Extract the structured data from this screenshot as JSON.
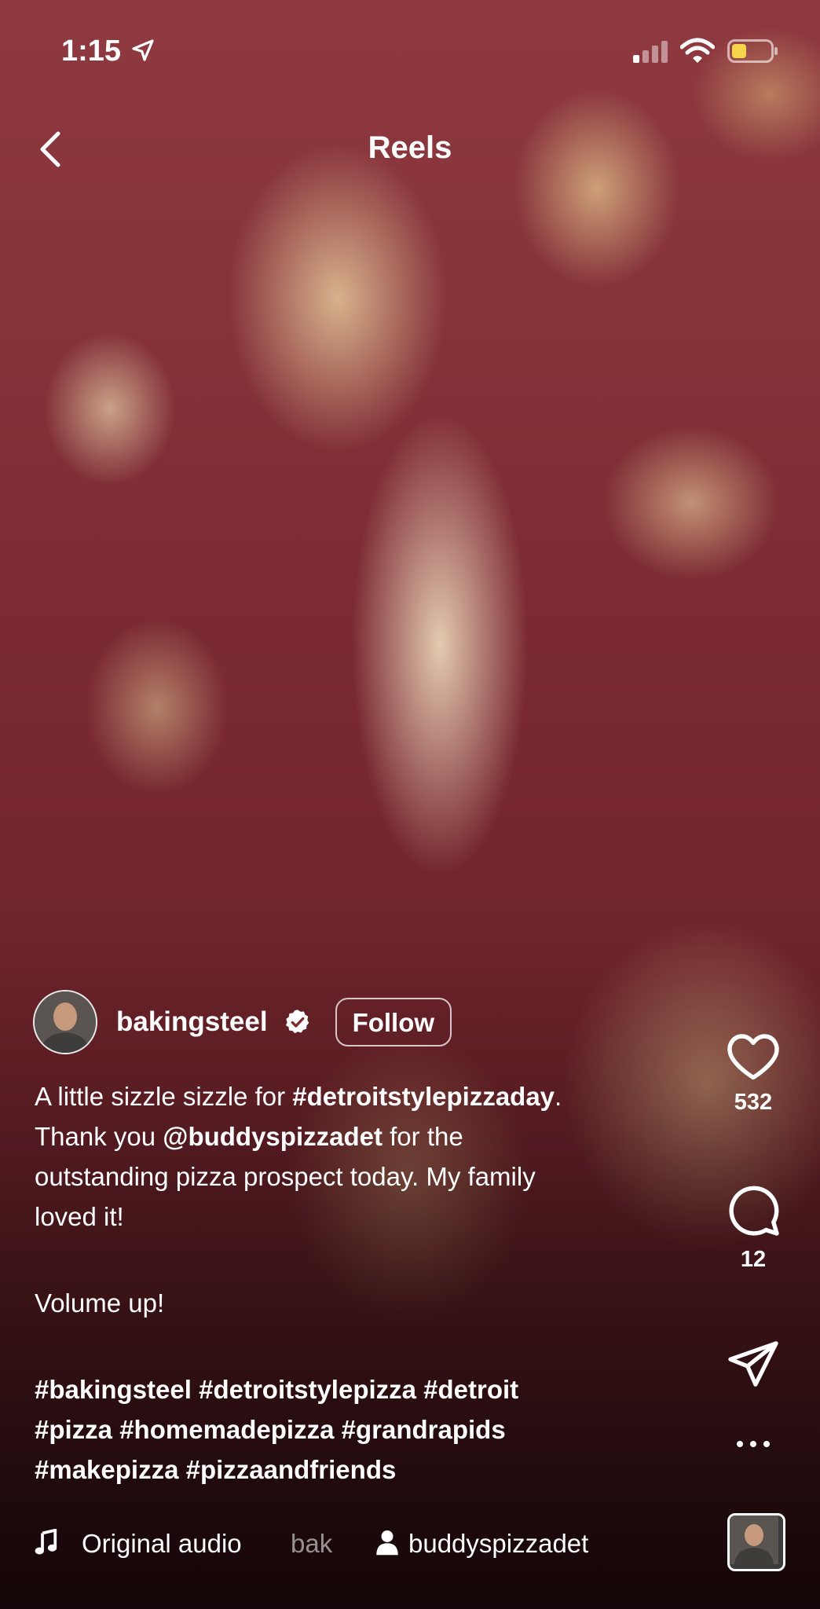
{
  "status_bar": {
    "time": "1:15"
  },
  "header": {
    "title": "Reels"
  },
  "author": {
    "username": "bakingsteel",
    "follow_label": "Follow"
  },
  "caption": {
    "line1_prefix": "A little sizzle sizzle for ",
    "line1_tag": "#detroitstylepizzaday",
    "line1_suffix": ".",
    "line2_prefix": "Thank you ",
    "line2_mention": "@buddyspizzadet",
    "line2_suffix": " for the",
    "line3": "outstanding pizza prospect today.  My family",
    "line4": "loved it!",
    "line5": "Volume up!",
    "hashtags_line1": "#bakingsteel #detroitstylepizza #detroit",
    "hashtags_line2": "#pizza #homemadepizza #grandrapids",
    "hashtags_line3": "#makepizza #pizzaandfriends"
  },
  "actions": {
    "likes": "532",
    "comments": "12"
  },
  "audio": {
    "title": "Original audio",
    "faded_text": "bak",
    "user": "buddyspizzadet"
  },
  "colors": {
    "text": "#ffffff",
    "overlay_sauce": "#7b2a32",
    "battery_fill": "#f5d34a"
  }
}
